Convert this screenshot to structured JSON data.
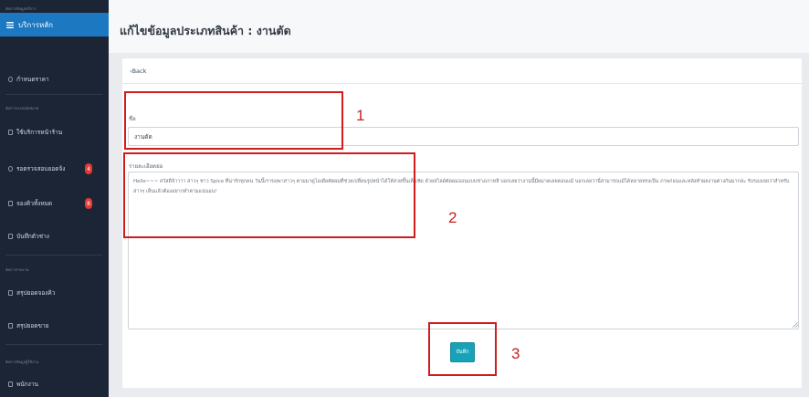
{
  "sidebar": {
    "top_caption": "จัดการข้อมูลบริการ",
    "main_service": "บริการหลัก",
    "pricing": "กำหนดราคา",
    "booking_caption": "จัดการระบบนัดหมาย",
    "service_in_store": "ใช้บริการหน้าร้าน",
    "pending_payment": "รอตรวจสอบยอดจ้ง",
    "pending_badge": "4",
    "queue_booking": "จองคิวทั้งหมด",
    "queue_badge": "8",
    "barber_schedule": "บันทึกตัวช่าง",
    "report_caption": "จัดการรายงาน",
    "booking_summary": "สรุปยอดจองคิว",
    "income_summary": "สรุปยอดขาย",
    "user_caption": "จัดการข้อมูลผู้ใช้งาน",
    "staff": "พนักงาน"
  },
  "header": {
    "title": "แก้ไขข้อมูลประเภทสินค้า : งานตัด"
  },
  "card": {
    "back_label": "‹Back"
  },
  "form": {
    "name_label": "ชื่อ",
    "name_value": "งานตัด",
    "description_label": "รายละเอียดย่อ",
    "description_value": "Hello~~~ สวัสดีจ้าาาา สาวๆ ชาว Spice ที่น่ารักทุกคน วันนี้เราขอพาสาวๆ ตามมาดูไอเดียตัดผมที่ช่วยเปลี่ยนรูปหน้าได้ให้สวยขึ้นเห็นชัด ด้วยสไลด์ตัดผมออนแบบช่างเกาหลี บอกเลยว่างานนี้มีผมาดเลยคอนแม้ บอกเลยว่านี่สามารถแม้ได้หลายทรงเป็น ภาพก่อนและหลังทำผลงานต่างกันมากล่ะ รับรองเลยว่าสำหรับสาวๆ เห็นแล้วต้องอยากทำตามแน่นอน!",
    "save_label": "บันทึก"
  },
  "annotations": {
    "marker_1": "1",
    "marker_2": "2",
    "marker_3": "3",
    "color": "#d01c1c"
  },
  "colors": {
    "sidebar_bg": "#1b2535",
    "active_item": "#1c78c0",
    "save_button": "#17a2b8",
    "badge": "#e53935"
  }
}
